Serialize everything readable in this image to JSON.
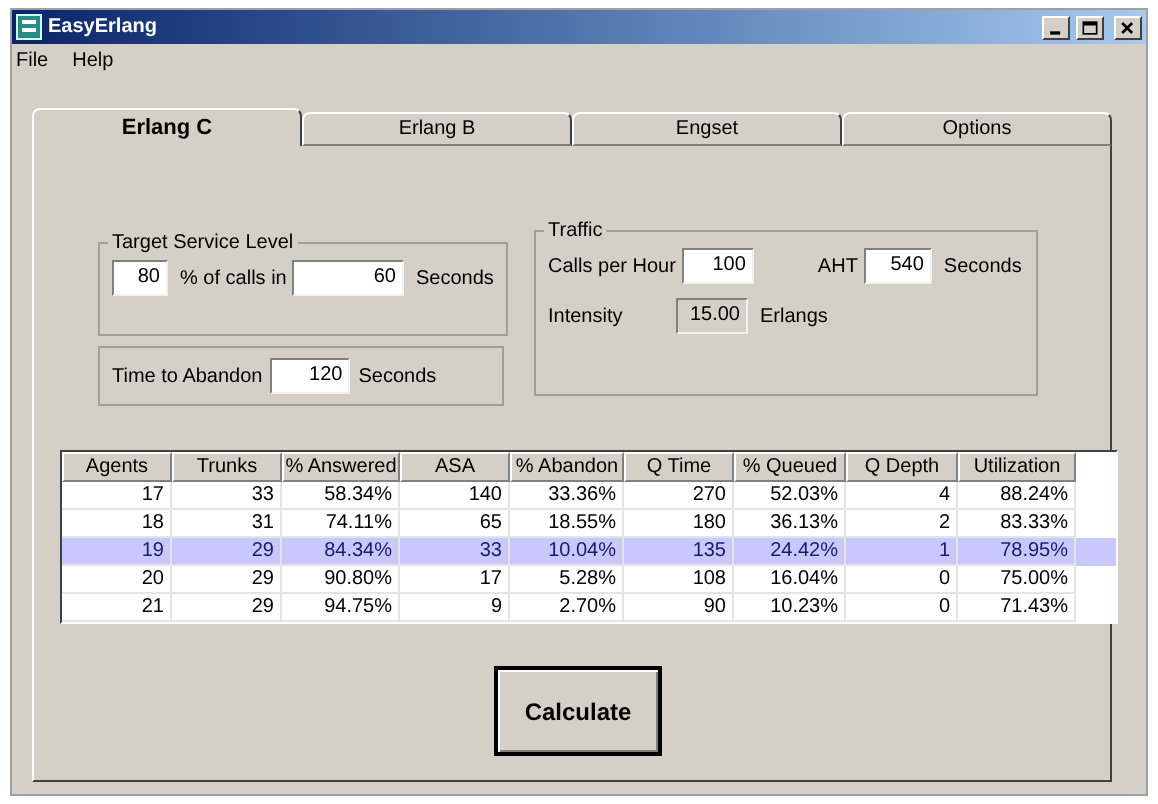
{
  "window": {
    "title": "EasyErlang"
  },
  "menu": [
    "File",
    "Help"
  ],
  "tabs": [
    {
      "label": "Erlang C",
      "selected": true
    },
    {
      "label": "Erlang B",
      "selected": false
    },
    {
      "label": "Engset",
      "selected": false
    },
    {
      "label": "Options",
      "selected": false
    }
  ],
  "target_service_level": {
    "title": "Target Service Level",
    "percent": "80",
    "percent_label": "% of calls in",
    "seconds": "60",
    "seconds_label": "Seconds"
  },
  "time_to_abandon": {
    "label": "Time to Abandon",
    "value": "120",
    "unit": "Seconds"
  },
  "traffic": {
    "title": "Traffic",
    "calls_label": "Calls per Hour",
    "calls": "100",
    "aht_label": "AHT",
    "aht": "540",
    "aht_unit": "Seconds",
    "intensity_label": "Intensity",
    "intensity": "15.00",
    "intensity_unit": "Erlangs"
  },
  "table": {
    "columns": [
      "Agents",
      "Trunks",
      "% Answered",
      "ASA",
      "% Abandon",
      "Q Time",
      "% Queued",
      "Q Depth",
      "Utilization"
    ],
    "rows": [
      {
        "selected": false,
        "cells": [
          "17",
          "33",
          "58.34%",
          "140",
          "33.36%",
          "270",
          "52.03%",
          "4",
          "88.24%"
        ]
      },
      {
        "selected": false,
        "cells": [
          "18",
          "31",
          "74.11%",
          "65",
          "18.55%",
          "180",
          "36.13%",
          "2",
          "83.33%"
        ]
      },
      {
        "selected": true,
        "cells": [
          "19",
          "29",
          "84.34%",
          "33",
          "10.04%",
          "135",
          "24.42%",
          "1",
          "78.95%"
        ]
      },
      {
        "selected": false,
        "cells": [
          "20",
          "29",
          "90.80%",
          "17",
          "5.28%",
          "108",
          "16.04%",
          "0",
          "75.00%"
        ]
      },
      {
        "selected": false,
        "cells": [
          "21",
          "29",
          "94.75%",
          "9",
          "2.70%",
          "90",
          "10.23%",
          "0",
          "71.43%"
        ]
      }
    ]
  },
  "calculate_button": "Calculate"
}
